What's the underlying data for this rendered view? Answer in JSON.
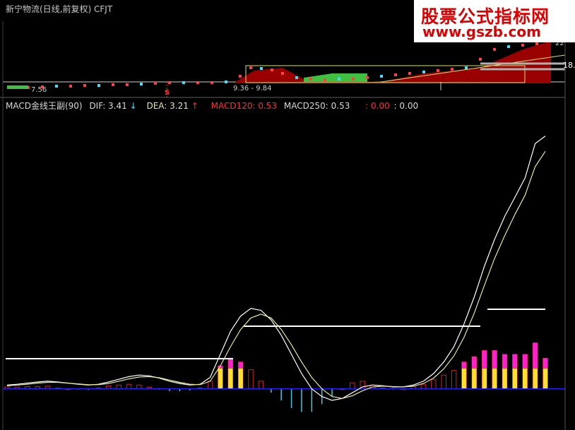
{
  "header": {
    "title": "新宁物流(日线,前复权) CFJT"
  },
  "indicator": {
    "name": "MACD金线王副(90)",
    "dif_label": "DIF: 3.41",
    "dif_arrow": "↓",
    "dea_label": "DEA: 3.21",
    "dea_arrow": "↑",
    "macd120_label": "MACD120: 0.53",
    "macd250_label": "MACD250: 0.53",
    "extra_label": ": 0.00",
    "extra2_label": ": 0.00"
  },
  "price_panel": {
    "low_label": "7.56",
    "range_label": "9.36 - 9.84",
    "right_label": "18.",
    "right_label2": "22",
    "marker_label": "S"
  },
  "watermark": {
    "line1": "股票公式指标网",
    "line2": "www.gszb.com"
  },
  "colors": {
    "dif": "#ffffff",
    "dea": "#e8e890",
    "bar_pos": "#d02020",
    "bar_neg": "#40c8e0",
    "magenta": "#ff20d0",
    "yellow": "#ffe030",
    "zero_line": "#2020ff"
  },
  "chart_data": {
    "type": "line",
    "title": "MACD金线王副(90)",
    "series": [
      {
        "name": "DIF",
        "values": [
          0.1,
          0.12,
          0.15,
          0.18,
          0.2,
          0.18,
          0.15,
          0.12,
          0.1,
          0.12,
          0.18,
          0.25,
          0.32,
          0.36,
          0.34,
          0.28,
          0.2,
          0.14,
          0.1,
          0.12,
          0.3,
          0.9,
          1.5,
          1.9,
          2.1,
          2.05,
          1.8,
          1.4,
          0.9,
          0.4,
          0.0,
          -0.2,
          -0.3,
          -0.25,
          -0.1,
          0.05,
          0.1,
          0.08,
          0.05,
          0.05,
          0.1,
          0.2,
          0.4,
          0.7,
          1.1,
          1.7,
          2.4,
          3.2,
          3.9,
          4.5,
          5.0,
          5.5,
          6.4,
          6.6
        ]
      },
      {
        "name": "DEA",
        "values": [
          0.08,
          0.1,
          0.12,
          0.15,
          0.17,
          0.17,
          0.15,
          0.13,
          0.11,
          0.11,
          0.14,
          0.2,
          0.26,
          0.31,
          0.32,
          0.29,
          0.23,
          0.17,
          0.12,
          0.11,
          0.2,
          0.6,
          1.1,
          1.55,
          1.85,
          1.95,
          1.85,
          1.55,
          1.15,
          0.7,
          0.3,
          0.0,
          -0.2,
          -0.25,
          -0.18,
          -0.05,
          0.05,
          0.07,
          0.06,
          0.05,
          0.07,
          0.14,
          0.28,
          0.52,
          0.86,
          1.35,
          1.98,
          2.7,
          3.4,
          4.0,
          4.55,
          5.05,
          5.8,
          6.2
        ]
      }
    ],
    "histogram": [
      0.05,
      0.05,
      0.06,
      0.06,
      0.07,
      0.02,
      0.0,
      -0.02,
      -0.03,
      0.02,
      0.08,
      0.1,
      0.12,
      0.1,
      0.04,
      -0.02,
      -0.06,
      -0.06,
      -0.04,
      0.02,
      0.2,
      0.6,
      0.8,
      0.7,
      0.5,
      0.2,
      -0.1,
      -0.3,
      -0.5,
      -0.6,
      -0.6,
      -0.4,
      -0.2,
      0.0,
      0.16,
      0.2,
      0.1,
      0.02,
      -0.02,
      0.0,
      0.06,
      0.12,
      0.24,
      0.36,
      0.48,
      0.7,
      0.84,
      1.0,
      1.0,
      0.9,
      0.9,
      0.9,
      1.2,
      0.8
    ],
    "reference_lines": [
      0.53
    ],
    "ylim": [
      -1.0,
      7.2
    ]
  }
}
